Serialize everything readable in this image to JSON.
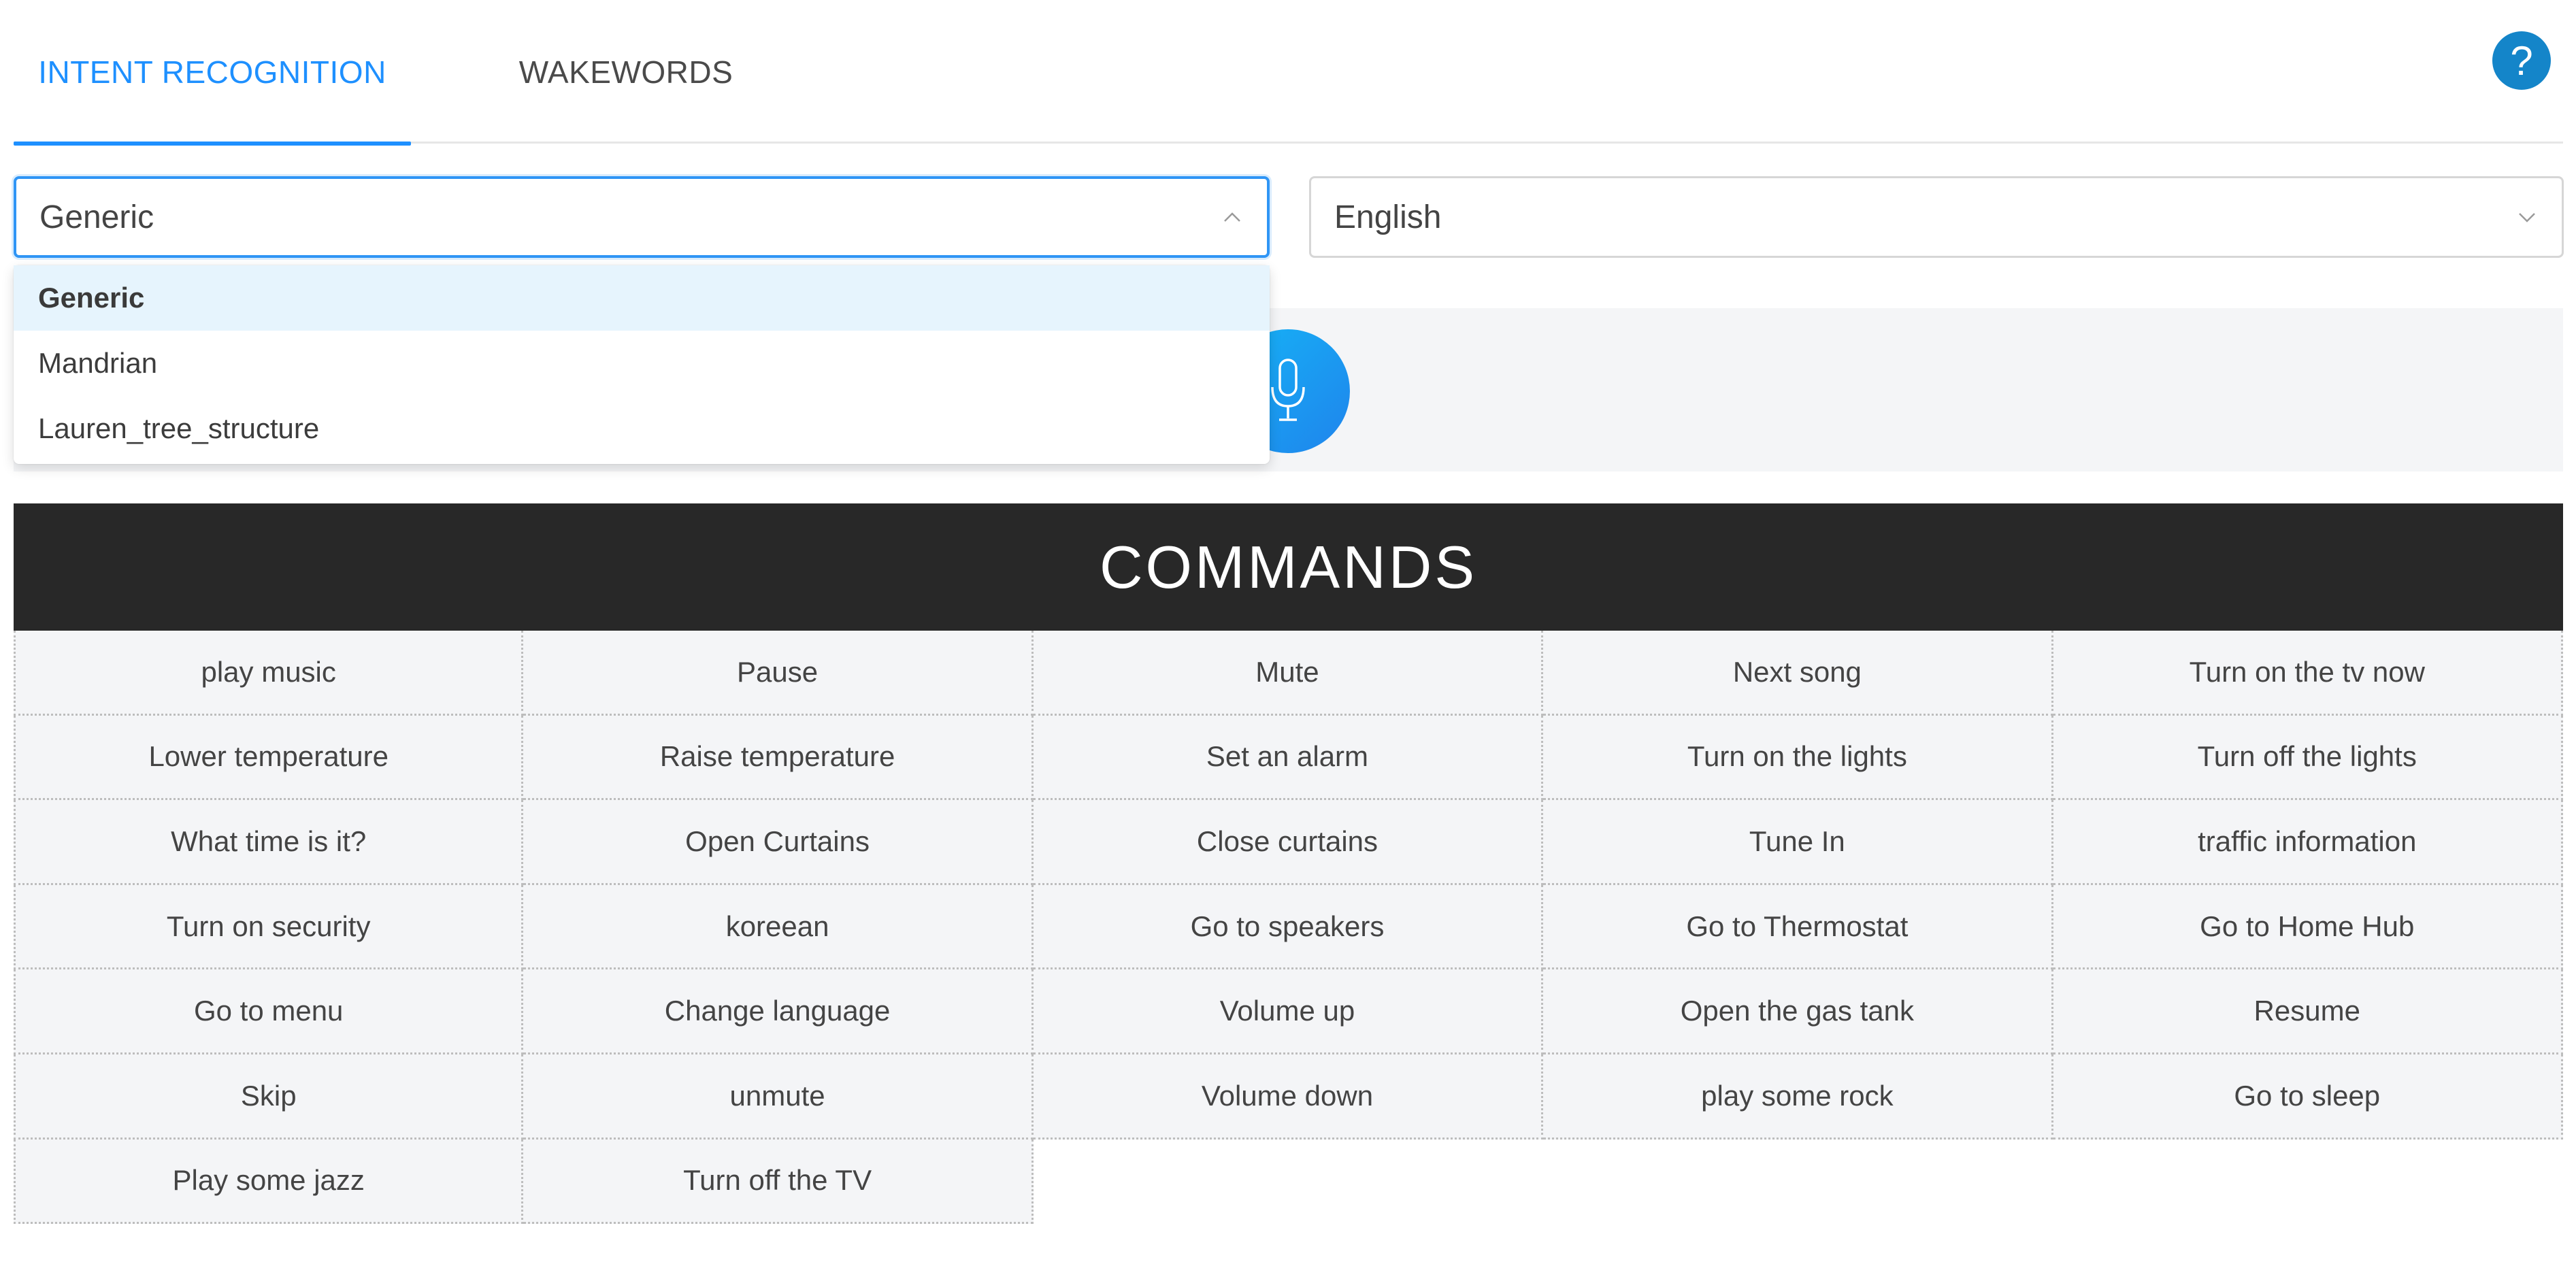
{
  "tabs": [
    {
      "label": "INTENT RECOGNITION",
      "active": true
    },
    {
      "label": "WAKEWORDS",
      "active": false
    }
  ],
  "help": {
    "icon": "help-icon",
    "label": "?"
  },
  "model_select": {
    "value": "Generic",
    "open": true,
    "options": [
      "Generic",
      "Mandrian",
      "Lauren_tree_structure"
    ]
  },
  "language_select": {
    "value": "English"
  },
  "recorder": {
    "icon": "microphone-icon"
  },
  "commands": {
    "title": "COMMANDS",
    "items": [
      "play music",
      "Pause",
      "Mute",
      "Next song",
      "Turn on the tv now",
      "Lower temperature",
      "Raise temperature",
      "Set an alarm",
      "Turn on the lights",
      "Turn off the lights",
      "What time is it?",
      "Open Curtains",
      "Close curtains",
      "Tune In",
      "traffic information",
      "Turn on security",
      "koreean",
      "Go to speakers",
      "Go to Thermostat",
      "Go to Home Hub",
      "Go to menu",
      "Change language",
      "Volume up",
      "Open the gas tank",
      "Resume",
      "Skip",
      "unmute",
      "Volume down",
      "play some rock",
      "Go to sleep",
      "Play some jazz",
      "Turn off the TV"
    ]
  },
  "colors": {
    "accent": "#1e90ff",
    "header_bg": "#282828",
    "cell_bg": "#f4f5f7",
    "selected_option_bg": "#e6f4fd"
  }
}
